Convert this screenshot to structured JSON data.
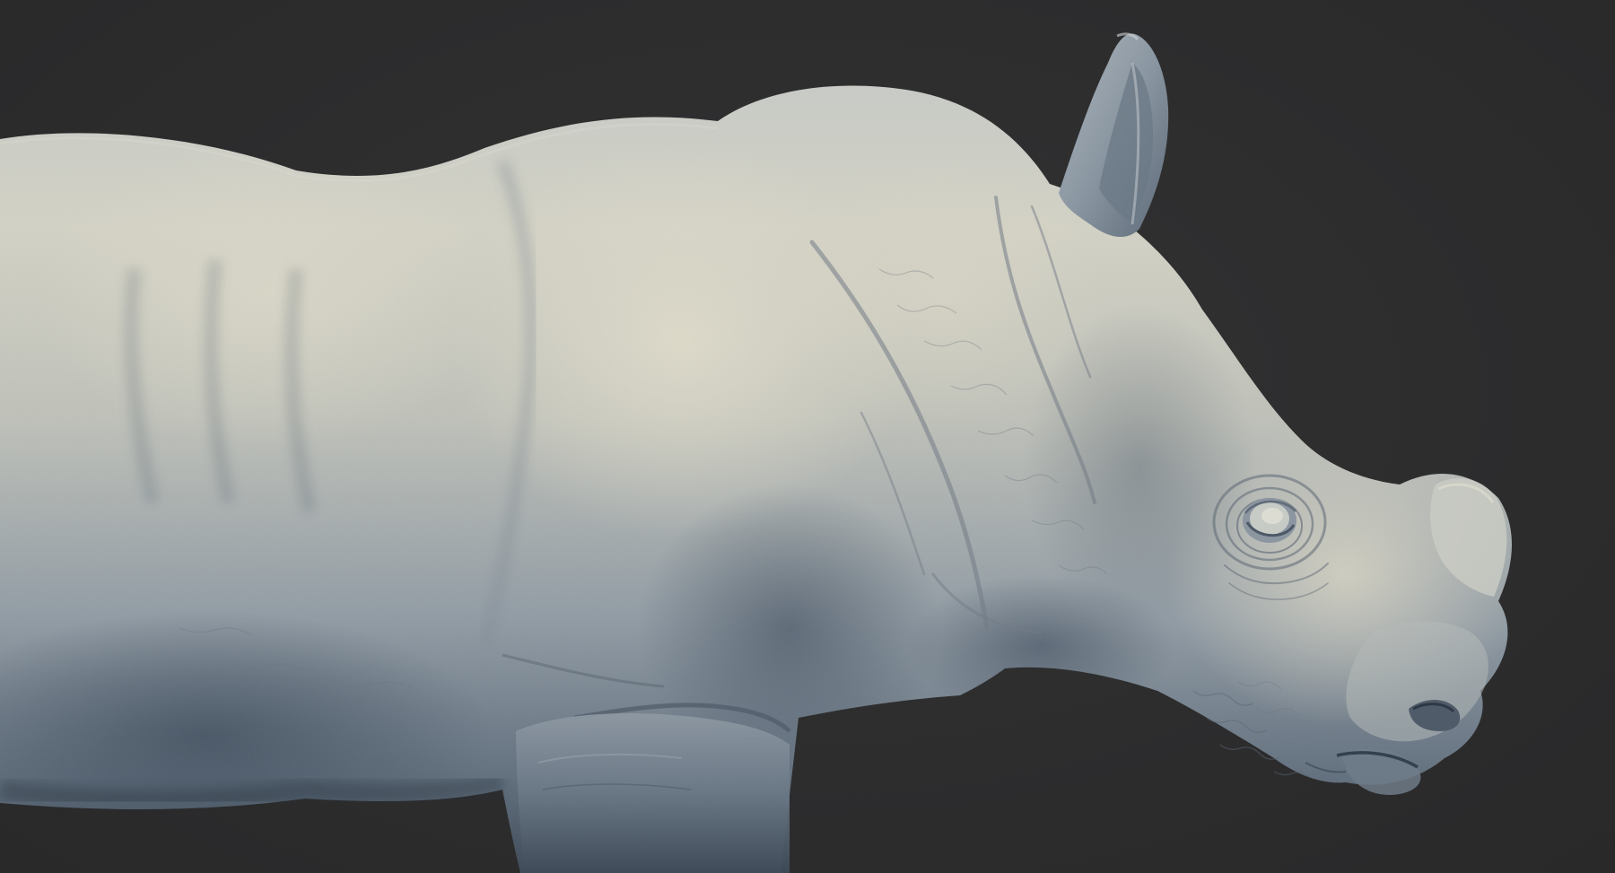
{
  "scene": {
    "subject": "rhino-sculpt",
    "colors": {
      "background": "#2c2c2d",
      "clay_highlight": "#d9d6c8",
      "clay_mid": "#a7afb3",
      "clay_shadow": "#4f5c6a",
      "rim_shadow": "#2f3946",
      "crease": "#6d6f78"
    }
  }
}
